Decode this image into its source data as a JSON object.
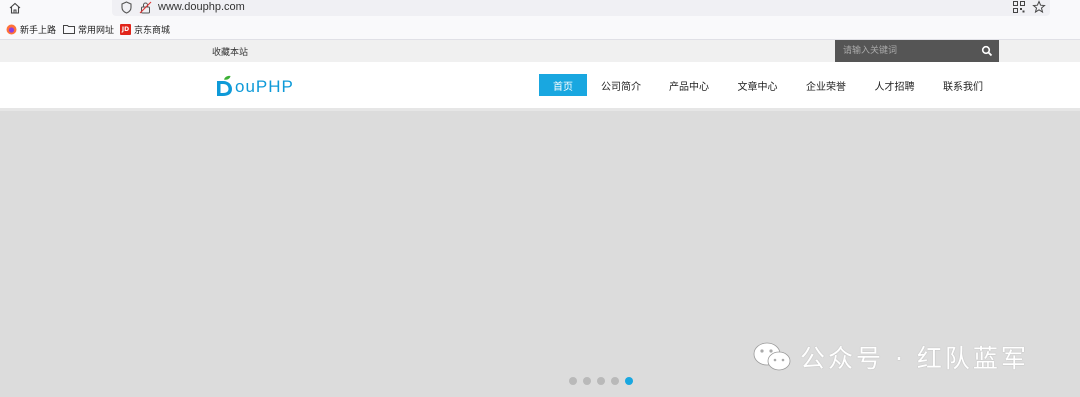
{
  "browser": {
    "url": "www.douphp.com",
    "bookmarks": [
      "新手上路",
      "常用网址",
      "京东商城"
    ],
    "jd_badge": "JD"
  },
  "topbar": {
    "favorite_link": "收藏本站",
    "search_placeholder": "请输入关键词"
  },
  "header": {
    "logo_text": "ouPHP",
    "nav": [
      {
        "label": "首页",
        "active": true
      },
      {
        "label": "公司简介",
        "active": false
      },
      {
        "label": "产品中心",
        "active": false
      },
      {
        "label": "文章中心",
        "active": false
      },
      {
        "label": "企业荣誉",
        "active": false
      },
      {
        "label": "人才招聘",
        "active": false
      },
      {
        "label": "联系我们",
        "active": false
      }
    ]
  },
  "banner": {
    "slide_count": 5,
    "active_slide": 5
  },
  "watermark": {
    "text": "公众号 · 红队蓝军"
  },
  "colors": {
    "accent": "#19a7e0",
    "logo": "#0e9ad8",
    "banner_bg": "#dcdcdc",
    "search_bg": "#555555"
  }
}
